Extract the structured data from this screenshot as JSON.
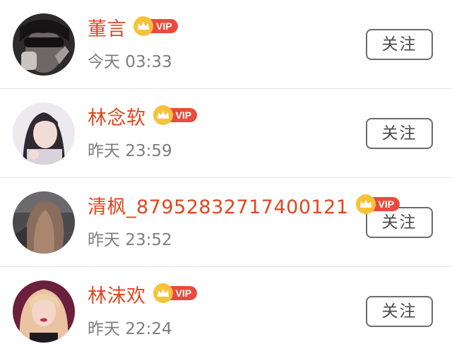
{
  "colors": {
    "username": "#e0461e",
    "time": "#7d7d7d",
    "vip_tag": "#e94b3c",
    "vip_crown": "#f7c23a",
    "button_border": "#6c6c6c"
  },
  "followers": [
    {
      "name": "董言",
      "vip_label": "VIP",
      "time": "今天 03:33",
      "follow_label": "关注",
      "avatar_icon": "avatar-photo-sunglasses"
    },
    {
      "name": "林念软",
      "vip_label": "VIP",
      "time": "昨天 23:59",
      "follow_label": "关注",
      "avatar_icon": "avatar-photo-girl"
    },
    {
      "name": "清枫_87952832717400121",
      "vip_label": "VIP",
      "time": "昨天 23:52",
      "follow_label": "关注",
      "avatar_icon": "avatar-photo-long-hair"
    },
    {
      "name": "林沫欢",
      "vip_label": "VIP",
      "time": "昨天 22:24",
      "follow_label": "关注",
      "avatar_icon": "avatar-photo-blonde"
    }
  ]
}
